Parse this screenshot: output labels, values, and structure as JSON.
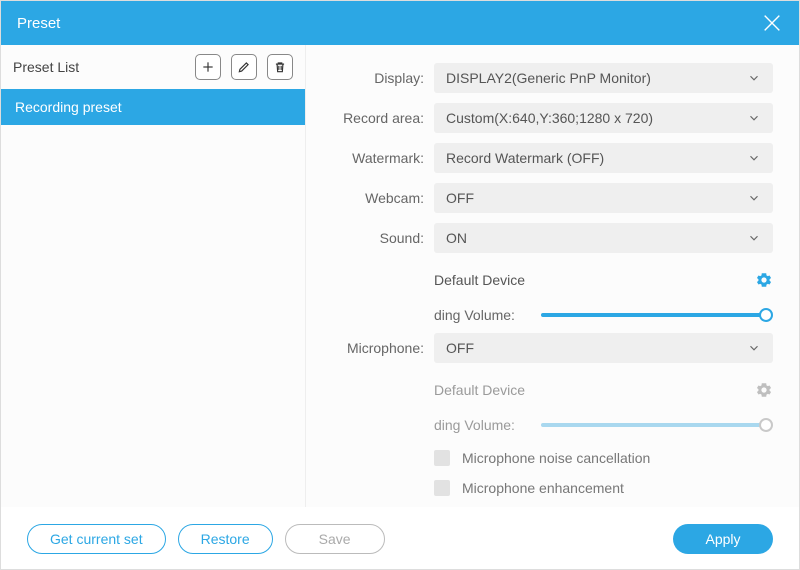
{
  "title": "Preset",
  "sidebar": {
    "header_label": "Preset List",
    "items": [
      "Recording preset"
    ]
  },
  "fields": {
    "display": {
      "label": "Display:",
      "value": "DISPLAY2(Generic PnP Monitor)"
    },
    "record_area": {
      "label": "Record area:",
      "value": "Custom(X:640,Y:360;1280 x 720)"
    },
    "watermark": {
      "label": "Watermark:",
      "value": "Record Watermark (OFF)"
    },
    "webcam": {
      "label": "Webcam:",
      "value": "OFF"
    },
    "sound": {
      "label": "Sound:",
      "value": "ON"
    },
    "microphone": {
      "label": "Microphone:",
      "value": "OFF"
    }
  },
  "sound_sub": {
    "device": "Default Device",
    "volume_label": "ding Volume:",
    "volume_pct": 97,
    "enabled": true
  },
  "mic_sub": {
    "device": "Default Device",
    "volume_label": "ding Volume:",
    "volume_pct": 97,
    "enabled": false,
    "noise_cancel_label": "Microphone noise cancellation",
    "enhance_label": "Microphone enhancement"
  },
  "buttons": {
    "get_current": "Get current set",
    "restore": "Restore",
    "save": "Save",
    "apply": "Apply"
  },
  "colors": {
    "accent": "#2ca7e4",
    "accent_light": "#a9d8ef",
    "track_gray": "#e6e6e6",
    "gear_gray": "#bfbfbf"
  }
}
